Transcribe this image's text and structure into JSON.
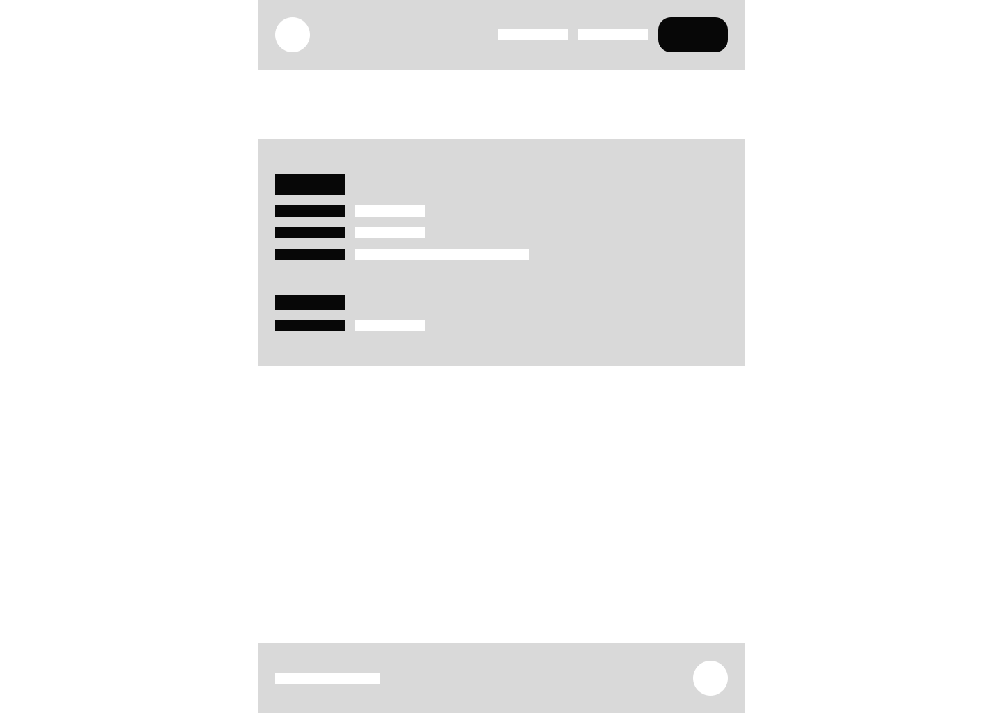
{
  "header": {
    "logo_icon": "circle-logo-icon",
    "nav_links": [
      "",
      ""
    ],
    "cta_label": ""
  },
  "card": {
    "sections": [
      {
        "heading": "",
        "rows": [
          {
            "label": "",
            "value": ""
          },
          {
            "label": "",
            "value": ""
          },
          {
            "label": "",
            "value": ""
          }
        ]
      },
      {
        "heading": "",
        "rows": [
          {
            "label": "",
            "value": ""
          }
        ]
      }
    ]
  },
  "footer": {
    "text": "",
    "icon": "circle-icon"
  },
  "colors": {
    "panel": "#d9d9d9",
    "placeholder_light": "#ffffff",
    "placeholder_dark": "#070707",
    "background": "#ffffff"
  }
}
